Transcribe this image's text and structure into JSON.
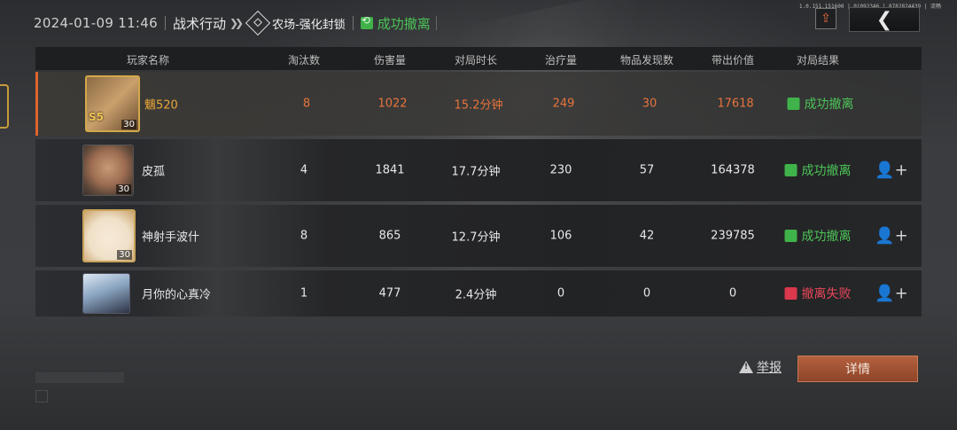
{
  "header": {
    "datetime": "2024-01-09 11:46",
    "mode": "战术行动",
    "chevrons": "❯❯",
    "map": "农场-强化封锁",
    "result": "成功撤离",
    "result_color": "#4cc457",
    "tiny_id": "1.0.151.151600 | 01092346 | 8782824439 | 流畅"
  },
  "actions": {
    "share_icon": "share-icon",
    "back_glyph": "❮",
    "report_label": "举报",
    "details_label": "详情"
  },
  "table": {
    "headers": [
      "玩家名称",
      "淘汰数",
      "伤害量",
      "对局时长",
      "治疗量",
      "物品发现数",
      "带出价值",
      "对局结果"
    ],
    "rows": [
      {
        "name": "魑520",
        "level": "30",
        "badge": "S5",
        "kills": "8",
        "damage": "1022",
        "duration": "15.2分钟",
        "healing": "249",
        "items": "30",
        "value": "17618",
        "result": "成功撤离",
        "result_type": "ok",
        "is_self": true,
        "add_friend": ""
      },
      {
        "name": "皮孤",
        "level": "30",
        "badge": "",
        "kills": "4",
        "damage": "1841",
        "duration": "17.7分钟",
        "healing": "230",
        "items": "57",
        "value": "164378",
        "result": "成功撤离",
        "result_type": "ok",
        "is_self": false,
        "add_friend": "👤+"
      },
      {
        "name": "神射手波什",
        "level": "30",
        "badge": "",
        "kills": "8",
        "damage": "865",
        "duration": "12.7分钟",
        "healing": "106",
        "items": "42",
        "value": "239785",
        "result": "成功撤离",
        "result_type": "ok",
        "is_self": false,
        "add_friend": "👤+"
      },
      {
        "name": "月你的心真冷",
        "level": "",
        "badge": "",
        "kills": "1",
        "damage": "477",
        "duration": "2.4分钟",
        "healing": "0",
        "items": "0",
        "value": "0",
        "result": "撤离失败",
        "result_type": "fail",
        "is_self": false,
        "add_friend": "👤+"
      }
    ]
  },
  "colors": {
    "accent_orange": "#e0632e",
    "self_name": "#e8a638",
    "success_green": "#4cc457",
    "fail_red": "#e8465a"
  }
}
